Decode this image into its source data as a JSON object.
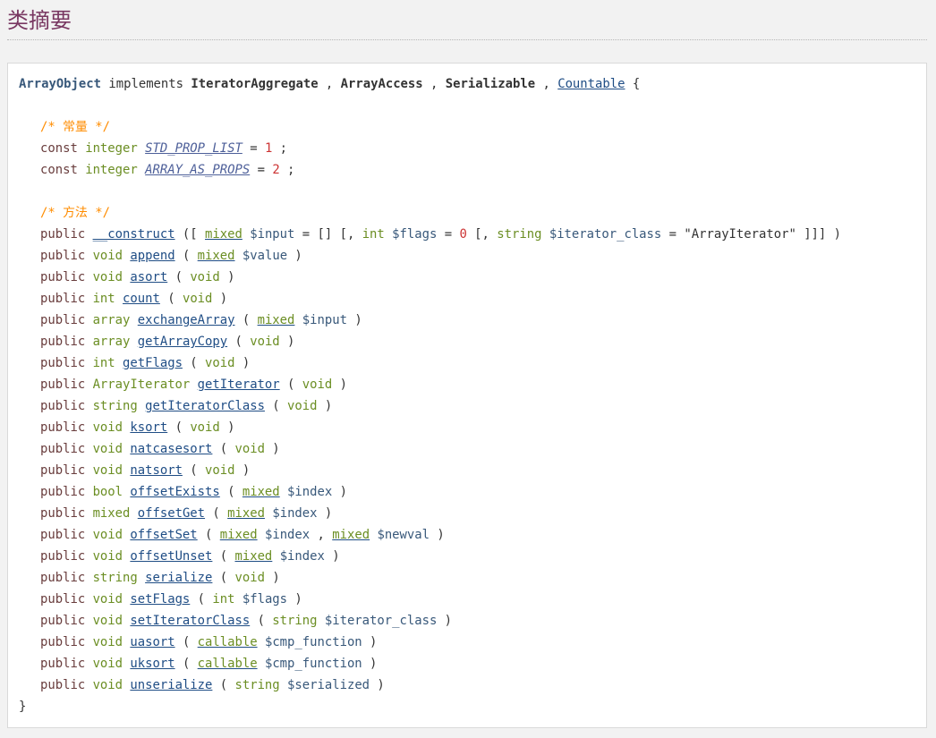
{
  "heading": "类摘要",
  "class_line": {
    "name": "ArrayObject",
    "implements_kw": "implements",
    "interfaces": [
      "IteratorAggregate",
      "ArrayAccess",
      "Serializable",
      "Countable"
    ],
    "open_brace": "{"
  },
  "constants_comment": "/* 常量 */",
  "constants": [
    {
      "const_kw": "const",
      "type": "integer",
      "name": "STD_PROP_LIST",
      "value": "1"
    },
    {
      "const_kw": "const",
      "type": "integer",
      "name": "ARRAY_AS_PROPS",
      "value": "2"
    }
  ],
  "methods_comment": "/* 方法 */",
  "construct": {
    "modifier": "public",
    "name": "__construct",
    "p1_type": "mixed",
    "p1_var": "$input",
    "p1_default": "[]",
    "p2_type": "int",
    "p2_var": "$flags",
    "p2_default": "0",
    "p3_type": "string",
    "p3_var": "$iterator_class",
    "p3_default": "\"ArrayIterator\""
  },
  "methods": [
    {
      "modifier": "public",
      "ret": "void",
      "name": "append",
      "ptype": "mixed",
      "pvar": "$value",
      "plink": true
    },
    {
      "modifier": "public",
      "ret": "void",
      "name": "asort",
      "ptype": "void",
      "pvar": "",
      "plink": false
    },
    {
      "modifier": "public",
      "ret": "int",
      "name": "count",
      "ptype": "void",
      "pvar": "",
      "plink": false
    },
    {
      "modifier": "public",
      "ret": "array",
      "name": "exchangeArray",
      "ptype": "mixed",
      "pvar": "$input",
      "plink": true
    },
    {
      "modifier": "public",
      "ret": "array",
      "name": "getArrayCopy",
      "ptype": "void",
      "pvar": "",
      "plink": false
    },
    {
      "modifier": "public",
      "ret": "int",
      "name": "getFlags",
      "ptype": "void",
      "pvar": "",
      "plink": false
    },
    {
      "modifier": "public",
      "ret": "ArrayIterator",
      "name": "getIterator",
      "ptype": "void",
      "pvar": "",
      "plink": false
    },
    {
      "modifier": "public",
      "ret": "string",
      "name": "getIteratorClass",
      "ptype": "void",
      "pvar": "",
      "plink": false
    },
    {
      "modifier": "public",
      "ret": "void",
      "name": "ksort",
      "ptype": "void",
      "pvar": "",
      "plink": false
    },
    {
      "modifier": "public",
      "ret": "void",
      "name": "natcasesort",
      "ptype": "void",
      "pvar": "",
      "plink": false
    },
    {
      "modifier": "public",
      "ret": "void",
      "name": "natsort",
      "ptype": "void",
      "pvar": "",
      "plink": false
    },
    {
      "modifier": "public",
      "ret": "bool",
      "name": "offsetExists",
      "ptype": "mixed",
      "pvar": "$index",
      "plink": true
    },
    {
      "modifier": "public",
      "ret": "mixed",
      "name": "offsetGet",
      "ptype": "mixed",
      "pvar": "$index",
      "plink": true
    },
    {
      "modifier": "public",
      "ret": "void",
      "name": "offsetSet",
      "ptype": "mixed",
      "pvar": "$index",
      "plink": true,
      "ptype2": "mixed",
      "pvar2": "$newval"
    },
    {
      "modifier": "public",
      "ret": "void",
      "name": "offsetUnset",
      "ptype": "mixed",
      "pvar": "$index",
      "plink": true
    },
    {
      "modifier": "public",
      "ret": "string",
      "name": "serialize",
      "ptype": "void",
      "pvar": "",
      "plink": false
    },
    {
      "modifier": "public",
      "ret": "void",
      "name": "setFlags",
      "ptype": "int",
      "pvar": "$flags",
      "plink": false
    },
    {
      "modifier": "public",
      "ret": "void",
      "name": "setIteratorClass",
      "ptype": "string",
      "pvar": "$iterator_class",
      "plink": false
    },
    {
      "modifier": "public",
      "ret": "void",
      "name": "uasort",
      "ptype": "callable",
      "pvar": "$cmp_function",
      "plink": true
    },
    {
      "modifier": "public",
      "ret": "void",
      "name": "uksort",
      "ptype": "callable",
      "pvar": "$cmp_function",
      "plink": true
    },
    {
      "modifier": "public",
      "ret": "void",
      "name": "unserialize",
      "ptype": "string",
      "pvar": "$serialized",
      "plink": false
    }
  ],
  "close_brace": "}"
}
